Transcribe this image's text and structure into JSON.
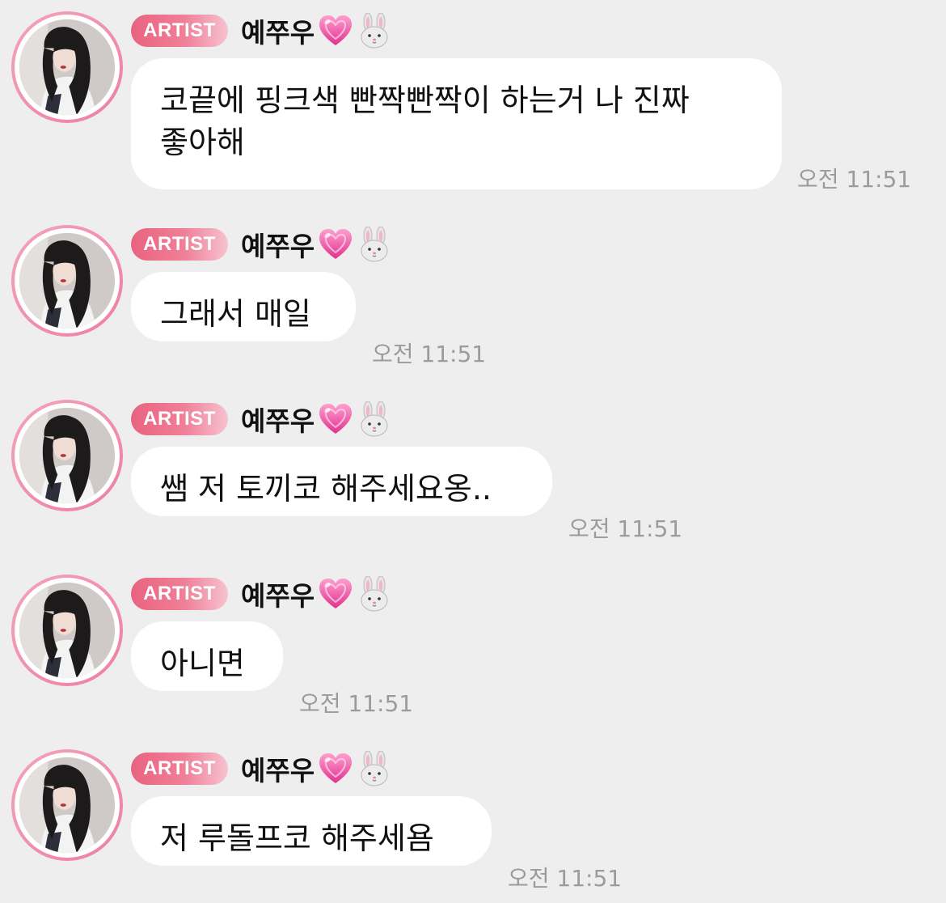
{
  "sender": {
    "badge": "ARTIST",
    "name": "예쭈우",
    "emojis": [
      "heart-icon",
      "rabbit-icon"
    ]
  },
  "colors": {
    "background": "#eeeeee",
    "bubble": "#ffffff",
    "badge_start": "#e9637f",
    "badge_end": "#f7c3cf",
    "avatar_ring": "#ee7fa1",
    "timestamp": "#9b9b9b"
  },
  "messages": [
    {
      "text": "코끝에 핑크색 빤짝빤짝이 하는거 나 진짜\n좋아해",
      "time": "오전 11:51"
    },
    {
      "text": "그래서 매일",
      "time": "오전 11:51"
    },
    {
      "text": "쌤 저 토끼코 해주세요옹..",
      "time": "오전 11:51"
    },
    {
      "text": "아니면",
      "time": "오전 11:51"
    },
    {
      "text": "저 루돌프코 해주세욤",
      "time": "오전 11:51"
    }
  ]
}
